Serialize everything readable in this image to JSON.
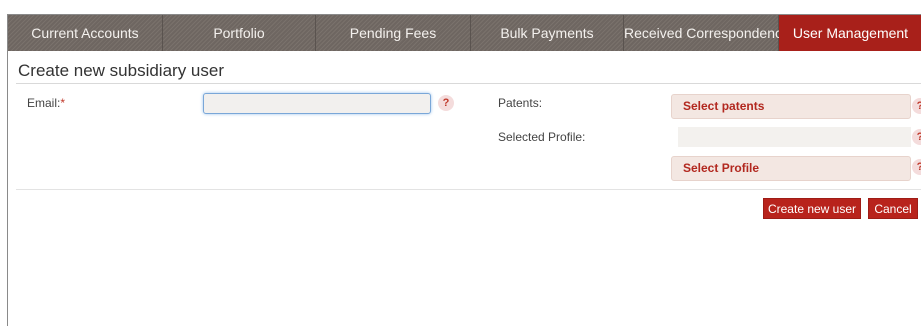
{
  "tabs": [
    {
      "label": "Current Accounts",
      "active": false
    },
    {
      "label": "Portfolio",
      "active": false
    },
    {
      "label": "Pending Fees",
      "active": false
    },
    {
      "label": "Bulk Payments",
      "active": false
    },
    {
      "label": "Received Correspondence",
      "active": false
    },
    {
      "label": "User Management",
      "active": true
    }
  ],
  "page": {
    "title": "Create new subsidiary user"
  },
  "form": {
    "email_label": "Email:",
    "required_marker": "*",
    "email_value": "",
    "patents_label": "Patents:",
    "select_patents_label": "Select patents",
    "selected_profile_label": "Selected Profile:",
    "selected_profile_value": "",
    "select_profile_label": "Select Profile",
    "help_glyph": "?"
  },
  "actions": {
    "create_label": "Create new user",
    "cancel_label": "Cancel"
  },
  "colors": {
    "accent": "#a8201a",
    "tab_bar": "#6e6661",
    "button_bg": "#b8231c",
    "select_bg": "#f3e7e2"
  },
  "icons": {
    "help": "question-mark-icon"
  }
}
